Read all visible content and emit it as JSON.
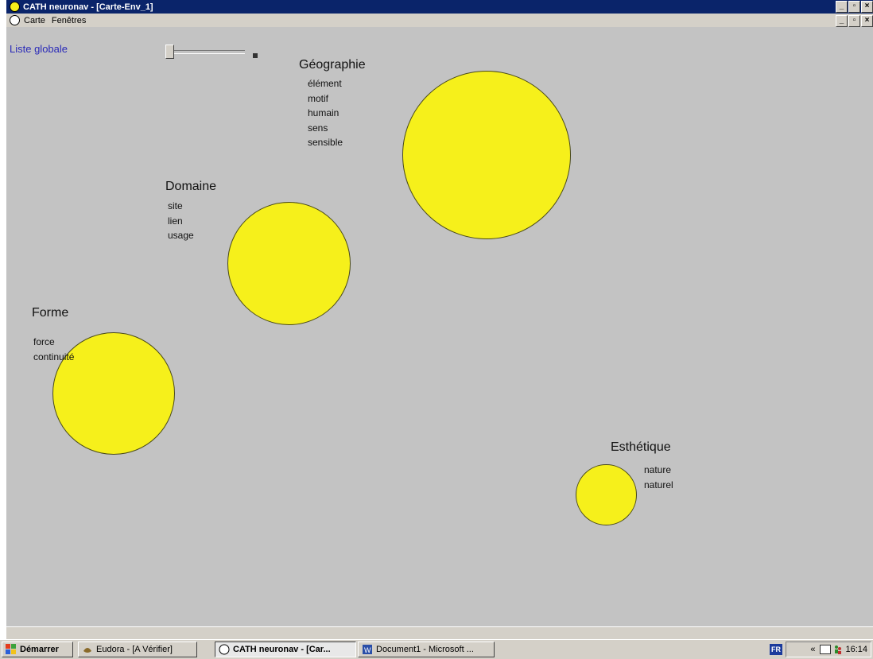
{
  "window": {
    "title": "CATH neuronav - [Carte-Env_1]",
    "controls": [
      "_",
      "▫",
      "×"
    ]
  },
  "menubar": {
    "items": [
      "Carte",
      "Fenêtres"
    ]
  },
  "canvas": {
    "liste_globale": "Liste globale",
    "groups": [
      {
        "title": "Géographie",
        "terms": [
          "élément",
          "motif",
          "humain",
          "sens",
          "sensible"
        ]
      },
      {
        "title": "Domaine",
        "terms": [
          "site",
          "lien",
          "usage"
        ]
      },
      {
        "title": "Forme",
        "terms": [
          "force",
          "continuité"
        ]
      },
      {
        "title": "Esthétique",
        "terms": [
          "nature",
          "naturel"
        ]
      }
    ],
    "circle_color": "#f6f01b"
  },
  "taskbar": {
    "start": "Démarrer",
    "buttons": [
      "Eudora - [A Vérifier]",
      "CATH neuronav - [Car...",
      "Document1 - Microsoft ..."
    ],
    "lang": "FR",
    "tray_arrows": "«",
    "clock": "16:14"
  }
}
